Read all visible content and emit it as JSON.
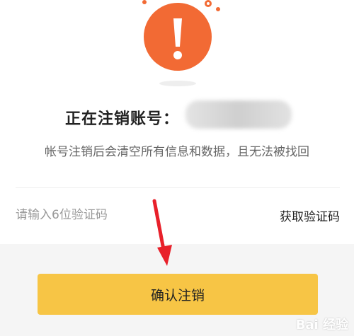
{
  "warning": {
    "icon": "exclamation-icon",
    "color": "#f26a34"
  },
  "header": {
    "title": "正在注销账号：",
    "account_blurred": true,
    "subtitle": "帐号注销后会清空所有信息和数据，且无法被找回"
  },
  "verification": {
    "input_placeholder": "请输入6位验证码",
    "input_value": "",
    "get_code_label": "获取验证码"
  },
  "actions": {
    "confirm_label": "确认注销",
    "confirm_color": "#f7c545"
  },
  "watermark": {
    "text": "Bai 经验"
  },
  "annotation": {
    "arrow_color": "#e8202a"
  }
}
